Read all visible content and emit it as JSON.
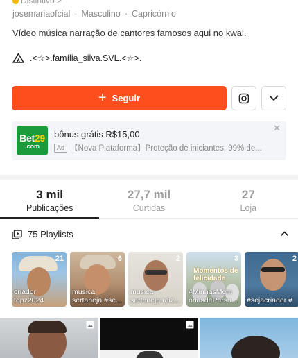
{
  "profile": {
    "badge_text": "Distintivo >",
    "username": "josemariaofcial",
    "gender": "Masculino",
    "sign": "Capricórnio",
    "bio": "Vídeo música narração de cantores famosos aqui no kwai.",
    "family_label": ".<☆>.família_silva.SVL.<☆>."
  },
  "actions": {
    "follow_label": "Seguir",
    "instagram_icon": "instagram-icon",
    "more_icon": "chevron-down-icon"
  },
  "ad": {
    "logo_line1_a": "Bet",
    "logo_line1_b": "29",
    "logo_line2": ".com",
    "title": "bônus grátis R$15,00",
    "tag": "Ad",
    "subtitle": "【Nova Plataforma】Proteção de iniciantes, 99% de...",
    "close_icon": "close-icon"
  },
  "stats": [
    {
      "num": "3 mil",
      "label": "Publicações"
    },
    {
      "num": "27,7 mil",
      "label": "Curtidas"
    },
    {
      "num": "27",
      "label": "Loja"
    }
  ],
  "playlists": {
    "header": "75 Playlists",
    "items": [
      {
        "count": "21",
        "caption": "criador topz2024"
      },
      {
        "count": "6",
        "caption": "musica sertaneja #se..."
      },
      {
        "count": "2",
        "caption": "musica sertaneja raiz..."
      },
      {
        "count": "3",
        "caption": "#MinhasMem óriasdePerso...",
        "overlay": "Momentos de felicidade"
      },
      {
        "count": "2",
        "caption": "#sejacriador #"
      }
    ]
  },
  "colors": {
    "accent": "#fe4e1e",
    "ad_logo_bg": "#1c9b3c"
  }
}
